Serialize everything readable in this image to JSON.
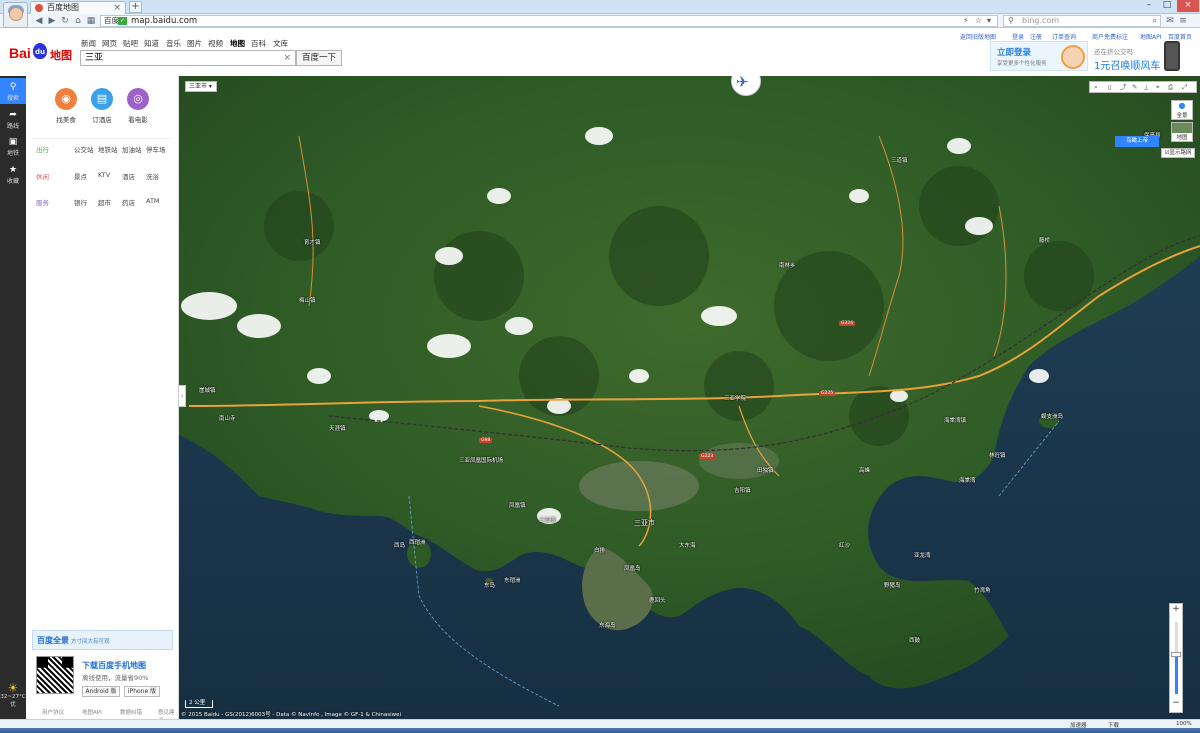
{
  "browser": {
    "tab_title": "百度地图",
    "url_site": "百度",
    "url": "map.baidu.com",
    "search_placeholder": "bing.com"
  },
  "header": {
    "logo_bai": "Bai",
    "logo_du": "du",
    "logo_ditu": "地图",
    "channels": [
      "新闻",
      "网页",
      "贴吧",
      "知道",
      "音乐",
      "图片",
      "视频",
      "地图",
      "百科",
      "文库"
    ],
    "active_channel": "地图",
    "search_value": "三亚",
    "search_button": "百度一下",
    "top_links": [
      "返回旧版地图",
      "登录",
      "注册",
      "订单查询",
      "商户免费标注",
      "地图API",
      "百度首页"
    ],
    "promo_login_title": "立即登录",
    "promo_login_sub": "享受更多个性化服务",
    "promo_car_line1": "还在挤公交吗",
    "promo_car_line2": "1元召唤顺风车"
  },
  "leftbar": {
    "items": [
      {
        "icon": "search-icon",
        "label": "搜索"
      },
      {
        "icon": "route-icon",
        "label": "路线"
      },
      {
        "icon": "bus-icon",
        "label": "地铁"
      },
      {
        "icon": "star-icon",
        "label": "收藏"
      }
    ],
    "weather_temp": "32~27°C",
    "weather_desc": "优"
  },
  "panel": {
    "top_categories": [
      {
        "label": "找美食",
        "color": "#f0803c"
      },
      {
        "label": "订酒店",
        "color": "#3aa0e8"
      },
      {
        "label": "看电影",
        "color": "#9b63c9"
      }
    ],
    "groups": [
      {
        "header": "出行",
        "items": [
          "公交站",
          "地铁站",
          "加油站",
          "停车场"
        ]
      },
      {
        "header": "休闲",
        "items": [
          "景点",
          "KTV",
          "酒店",
          "洗浴"
        ]
      },
      {
        "header": "服务",
        "items": [
          "银行",
          "超市",
          "药店",
          "ATM"
        ]
      }
    ],
    "panorama_title": "百度全景",
    "panorama_sub": "方寸间大有可观",
    "download_title": "下载百度手机地图",
    "download_sub": "离线使用，流量省90%",
    "android_btn": "Android 版",
    "iphone_btn": "iPhone 版",
    "footer_links": [
      "用户协议",
      "地图API",
      "数据纠错",
      "意见建议"
    ]
  },
  "map": {
    "city_selector": "三亚市",
    "tool_fullscreen": "全景",
    "tool_satellite": "地图",
    "tilt_button": "鸟瞰上帝",
    "road_network": "显示路网",
    "scale": "2 公里",
    "copyright": "© 2015 Baidu - GS(2012)6003号 - Data © NavInfo , Image © GF-1 & Chinasiwei",
    "labels": [
      {
        "t": "三亚市",
        "big": true
      },
      {
        "t": "天涯镇"
      },
      {
        "t": "育才镇"
      },
      {
        "t": "田独镇"
      },
      {
        "t": "三亚湾"
      },
      {
        "t": "海棠湾镇"
      },
      {
        "t": "三亚凤凰国际机场"
      },
      {
        "t": "亚龙湾"
      },
      {
        "t": "凤凰岛"
      },
      {
        "t": "鹿回头"
      },
      {
        "t": "东海岛"
      },
      {
        "t": "西瑁洲"
      },
      {
        "t": "东瑁洲"
      },
      {
        "t": "蜈支洲岛"
      },
      {
        "t": "南山寺"
      },
      {
        "t": "三亚学院"
      },
      {
        "t": "大东海"
      },
      {
        "t": "野猪岛"
      },
      {
        "t": "凤凰镇"
      },
      {
        "t": "吉阳镇"
      },
      {
        "t": "高峰"
      },
      {
        "t": "三道镇"
      },
      {
        "t": "林旺镇"
      },
      {
        "t": "南林乡"
      },
      {
        "t": "红沙"
      },
      {
        "t": "藤桥"
      },
      {
        "t": "保亭县"
      },
      {
        "t": "梅山镇"
      },
      {
        "t": "崖城镇"
      },
      {
        "t": "海棠湾"
      },
      {
        "t": "西岛"
      },
      {
        "t": "白排"
      },
      {
        "t": "东岛"
      },
      {
        "t": "竹湾角"
      },
      {
        "t": "西鼓"
      }
    ],
    "shields": [
      "G98",
      "G225",
      "G223",
      "G224"
    ]
  },
  "statusbar": {
    "left": "",
    "right_items": [
      "加速器",
      "下载",
      "100%"
    ]
  }
}
